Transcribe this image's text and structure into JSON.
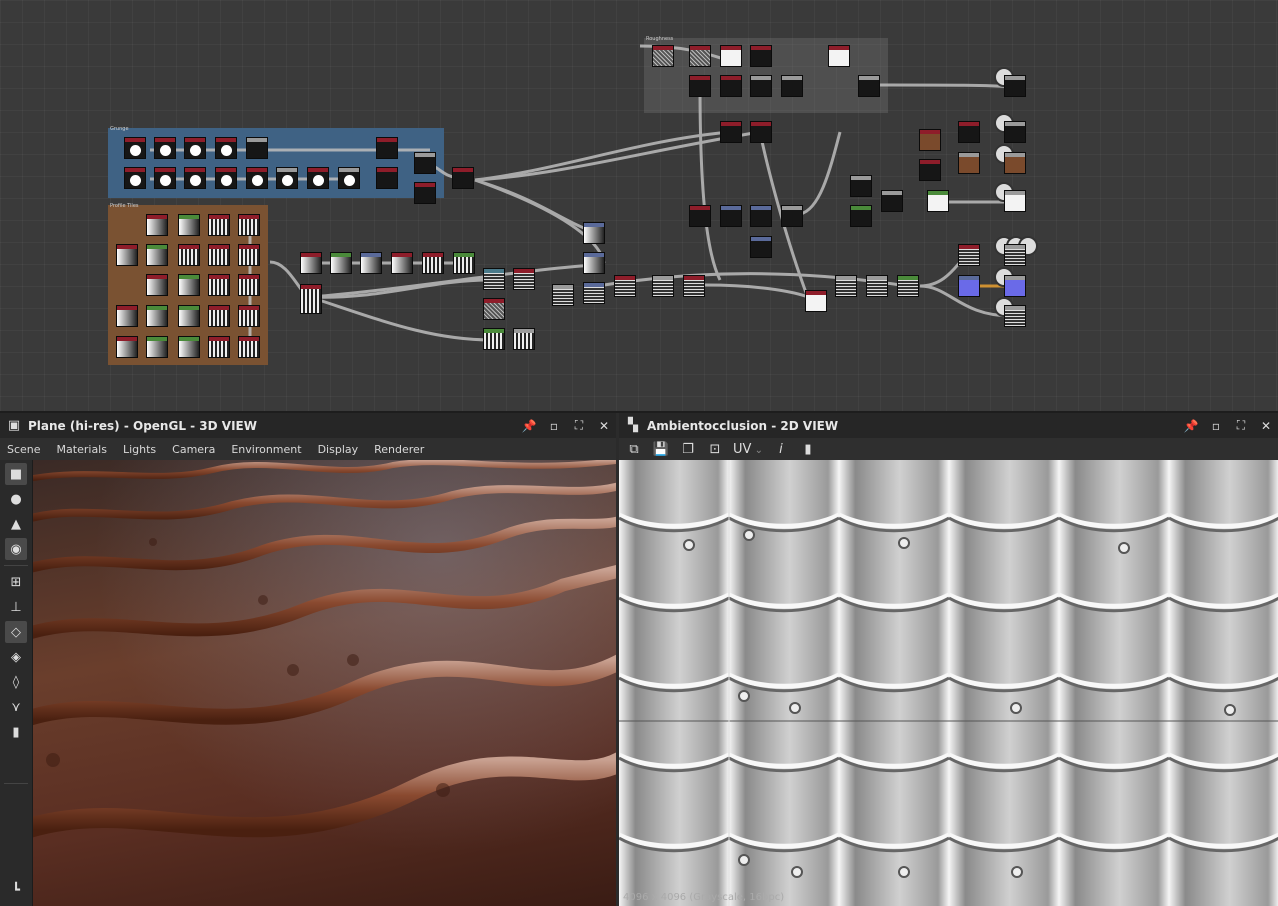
{
  "graph": {
    "frames": [
      {
        "label": "Roughness"
      },
      {
        "label": "Grunge"
      },
      {
        "label": "Profile Tiles"
      }
    ]
  },
  "panel3d": {
    "title": "Plane (hi-res) - OpenGL - 3D VIEW",
    "menu": [
      "Scene",
      "Materials",
      "Lights",
      "Camera",
      "Environment",
      "Display",
      "Renderer"
    ],
    "tools": [
      "camera-icon",
      "light-icon",
      "environment-icon",
      "render-settings-icon",
      "scene-icon",
      "axis-icon",
      "cube-icon",
      "mesh-icon",
      "plane-icon",
      "transform-icon",
      "stats-icon"
    ],
    "bottom_tool": "hierarchy-icon"
  },
  "panel2d": {
    "title": "Ambientocclusion - 2D VIEW",
    "toolbar": [
      "export-icon",
      "save-icon",
      "copy-icon",
      "fit-icon",
      "uv-dropdown",
      "info-icon",
      "histogram-icon"
    ],
    "uv_label": "UV",
    "status": "4096 x 4096 (Grayscale, 16bpc)"
  },
  "colors": {
    "frame_grunge": "#3f6284",
    "frame_profile": "#7a5232",
    "frame_roughness": "#5a5a5a",
    "node_header": "#8e1d2a",
    "wire": "#bdbdbd"
  }
}
